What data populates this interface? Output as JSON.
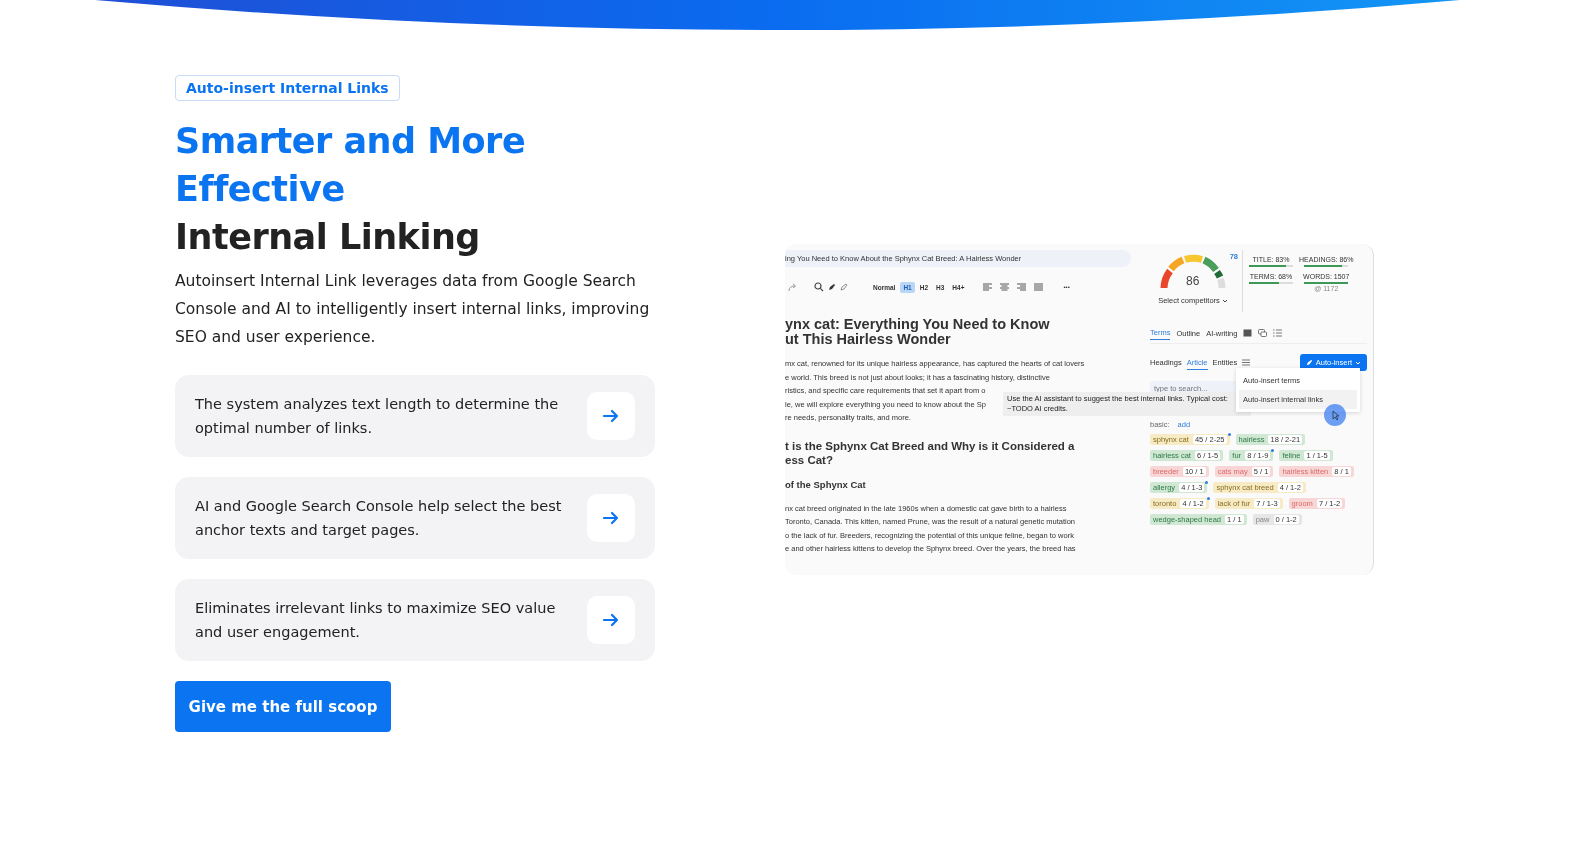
{
  "badge": "Auto-insert Internal Links",
  "title_lines": [
    {
      "text": "Smarter and More",
      "accent": true
    },
    {
      "text": "Effective",
      "accent": true
    },
    {
      "text": "Internal Linking",
      "accent": false
    }
  ],
  "description": "Autoinsert Internal Link leverages data from Google Search Console and AI to intelligently insert internal links, improving SEO and user experience.",
  "features": [
    {
      "text": "The system analyzes text length to determine the optimal number of links."
    },
    {
      "text": "AI and Google Search Console help select the best anchor texts and target pages."
    },
    {
      "text": "Eliminates irrelevant links to maximize SEO value and user engagement."
    }
  ],
  "cta": "Give me the full scoop",
  "editor": {
    "doc_title": "ing You Need to Know About the Sphynx Cat Breed: A Hairless Wonder",
    "styles": [
      {
        "label": "Normal",
        "selected": false
      },
      {
        "label": "H1",
        "selected": true
      },
      {
        "label": "H2",
        "selected": false
      },
      {
        "label": "H3",
        "selected": false
      },
      {
        "label": "H4+",
        "selected": false
      }
    ],
    "more": "•••",
    "blocks": [
      {
        "kind": "h1",
        "lines": [
          "ynx cat: Everything You Need to Know",
          "ut This Hairless Wonder"
        ]
      },
      {
        "kind": "p",
        "lines": [
          "mx cat, renowned for its unique hairless appearance, has captured the hearts of cat lovers",
          "e world. This breed is not just about looks; it has a fascinating history, distinctive",
          "ristics, and specific care requirements that set it apart from o",
          "le, we will explore everything you need to know about the Sp",
          "re needs, personality traits, and more."
        ]
      },
      {
        "kind": "h2",
        "lines": [
          "t is the Sphynx Cat Breed and Why is it Considered a",
          "ess Cat?"
        ]
      },
      {
        "kind": "h3",
        "lines": [
          "of the Sphynx Cat"
        ]
      },
      {
        "kind": "p",
        "lines": [
          "nx cat breed originated in the late 1960s when a domestic cat gave birth to a hairless",
          "Toronto, Canada. This kitten, named Prune, was the result of a natural genetic mutation",
          "o the lack of fur. Breeders, recognizing the potential of this unique feline, began to work",
          "e and other hairless kittens to develop the Sphynx breed. Over the years, the breed has"
        ]
      }
    ],
    "tooltip": [
      "Use the AI assistant to suggest the best internal links. Typical cost:",
      "~TODO AI credits."
    ],
    "score": "86",
    "competitor_score": "78",
    "select_competitors": "Select competitors",
    "metrics": [
      {
        "label": "TITLE: 83%",
        "level": 0.83
      },
      {
        "label": "HEADINGS: 86%",
        "level": 0.86
      },
      {
        "label": "TERMS: 68%",
        "level": 0.68
      },
      {
        "label": "WORDS: 1507",
        "level": 1,
        "note": "@ 1172"
      }
    ],
    "tabs": [
      {
        "label": "Terms",
        "selected": true
      },
      {
        "label": "Outline",
        "selected": false
      },
      {
        "label": "AI-writing",
        "selected": false
      }
    ],
    "subtabs": [
      {
        "label": "Headings",
        "selected": false
      },
      {
        "label": "Article",
        "selected": true
      },
      {
        "label": "Entities",
        "selected": false
      }
    ],
    "auto_insert": "Auto-insert",
    "search": {
      "placeholder": "type to search..."
    },
    "menu": [
      {
        "label": "Auto-insert terms"
      },
      {
        "label": "Auto-insert internal links"
      }
    ],
    "basic": "basic:",
    "add": "add",
    "terms": [
      {
        "name": "sphynx cat",
        "count": "45 / 2-25",
        "color": "#f7ebc6",
        "dot": true
      },
      {
        "name": "hairless",
        "count": "18 / 2-21",
        "color": "#cfe7d3",
        "dot": false
      },
      {
        "name": "hairless cat",
        "count": "6 / 1-5",
        "color": "#cfe7d3",
        "dot": false
      },
      {
        "name": "fur",
        "count": "8 / 1-9",
        "color": "#cfe7d3",
        "dot": true
      },
      {
        "name": "feline",
        "count": "1 / 1-5",
        "color": "#cfe7d3",
        "dot": false
      },
      {
        "name": "breeder",
        "count": "10 / 1",
        "color": "#f9d6d6",
        "dot": false
      },
      {
        "name": "cats may",
        "count": "5 / 1",
        "color": "#f9d6d6",
        "dot": false
      },
      {
        "name": "hairless kitten",
        "count": "8 / 1",
        "color": "#f9d6d6",
        "dot": false
      },
      {
        "name": "allergy",
        "count": "4 / 1-3",
        "color": "#cfe7d3",
        "dot": true
      },
      {
        "name": "sphynx cat breed",
        "count": "4 / 1-2",
        "color": "#f7ebc6",
        "dot": false
      },
      {
        "name": "toronto",
        "count": "4 / 1-2",
        "color": "#f7ebc6",
        "dot": true
      },
      {
        "name": "lack of fur",
        "count": "7 / 1-3",
        "color": "#f7ebc6",
        "dot": false
      },
      {
        "name": "groom",
        "count": "7 / 1-2",
        "color": "#f9d6d6",
        "dot": false
      },
      {
        "name": "wedge-shaped head",
        "count": "1 / 1",
        "color": "#cfe7d3",
        "dot": false
      },
      {
        "name": "paw",
        "count": "0 / 1-2",
        "color": "#e6e6e6",
        "dot": false
      }
    ]
  }
}
